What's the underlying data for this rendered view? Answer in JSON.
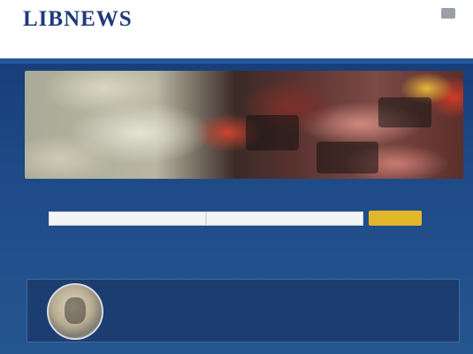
{
  "header": {
    "logo_text": "LIBNEWS",
    "logo_tagline": "",
    "top_links": [
      "",
      ""
    ],
    "nav": [
      "",
      "",
      "",
      ""
    ]
  },
  "hero": {
    "image_alt": ""
  },
  "search": {
    "label": "",
    "field1_placeholder": "",
    "field2_placeholder": "",
    "button_label": "",
    "hint": ""
  },
  "info_panel": {
    "text": ""
  },
  "colors": {
    "header_bg": "#ffffff",
    "main_bg": "#1f4c89",
    "panel_bg": "#1c3d6f",
    "accent_button": "#e3b72a",
    "hint_text": "#4fae6a"
  },
  "icons": {
    "seal": "seal-icon"
  }
}
